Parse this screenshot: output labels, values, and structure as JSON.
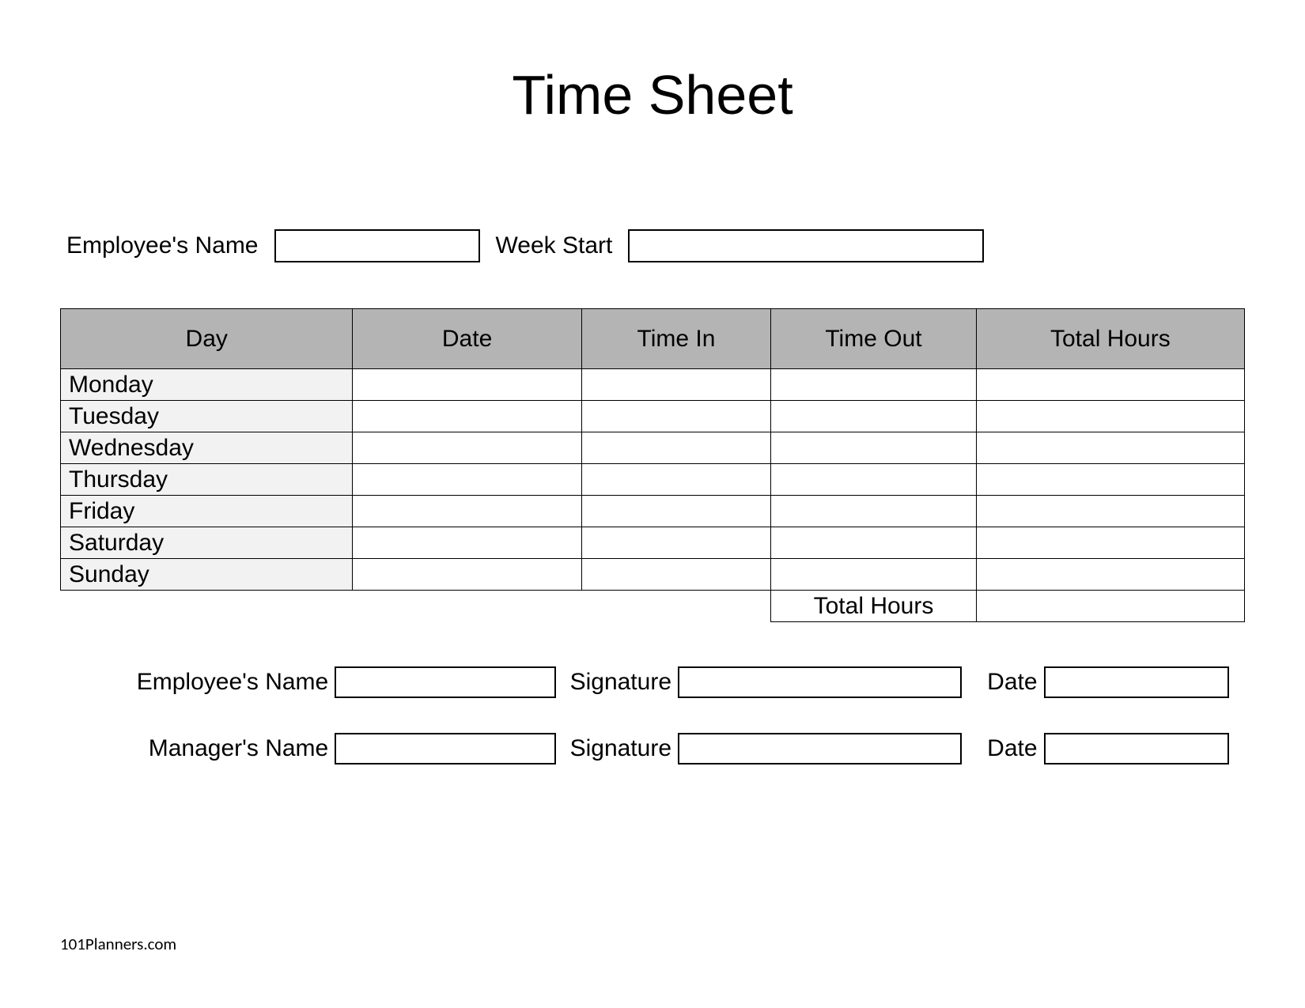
{
  "title": "Time Sheet",
  "top": {
    "employee_name_label": "Employee's Name",
    "week_start_label": "Week Start"
  },
  "headers": {
    "day": "Day",
    "date": "Date",
    "time_in": "Time In",
    "time_out": "Time Out",
    "total_hours": "Total Hours"
  },
  "days": [
    "Monday",
    "Tuesday",
    "Wednesday",
    "Thursday",
    "Friday",
    "Saturday",
    "Sunday"
  ],
  "total_hours_label": "Total Hours",
  "sign": {
    "employee_name_label": "Employee's Name",
    "manager_name_label": "Manager's Name",
    "signature_label": "Signature",
    "date_label": "Date"
  },
  "footer": "101Planners.com"
}
